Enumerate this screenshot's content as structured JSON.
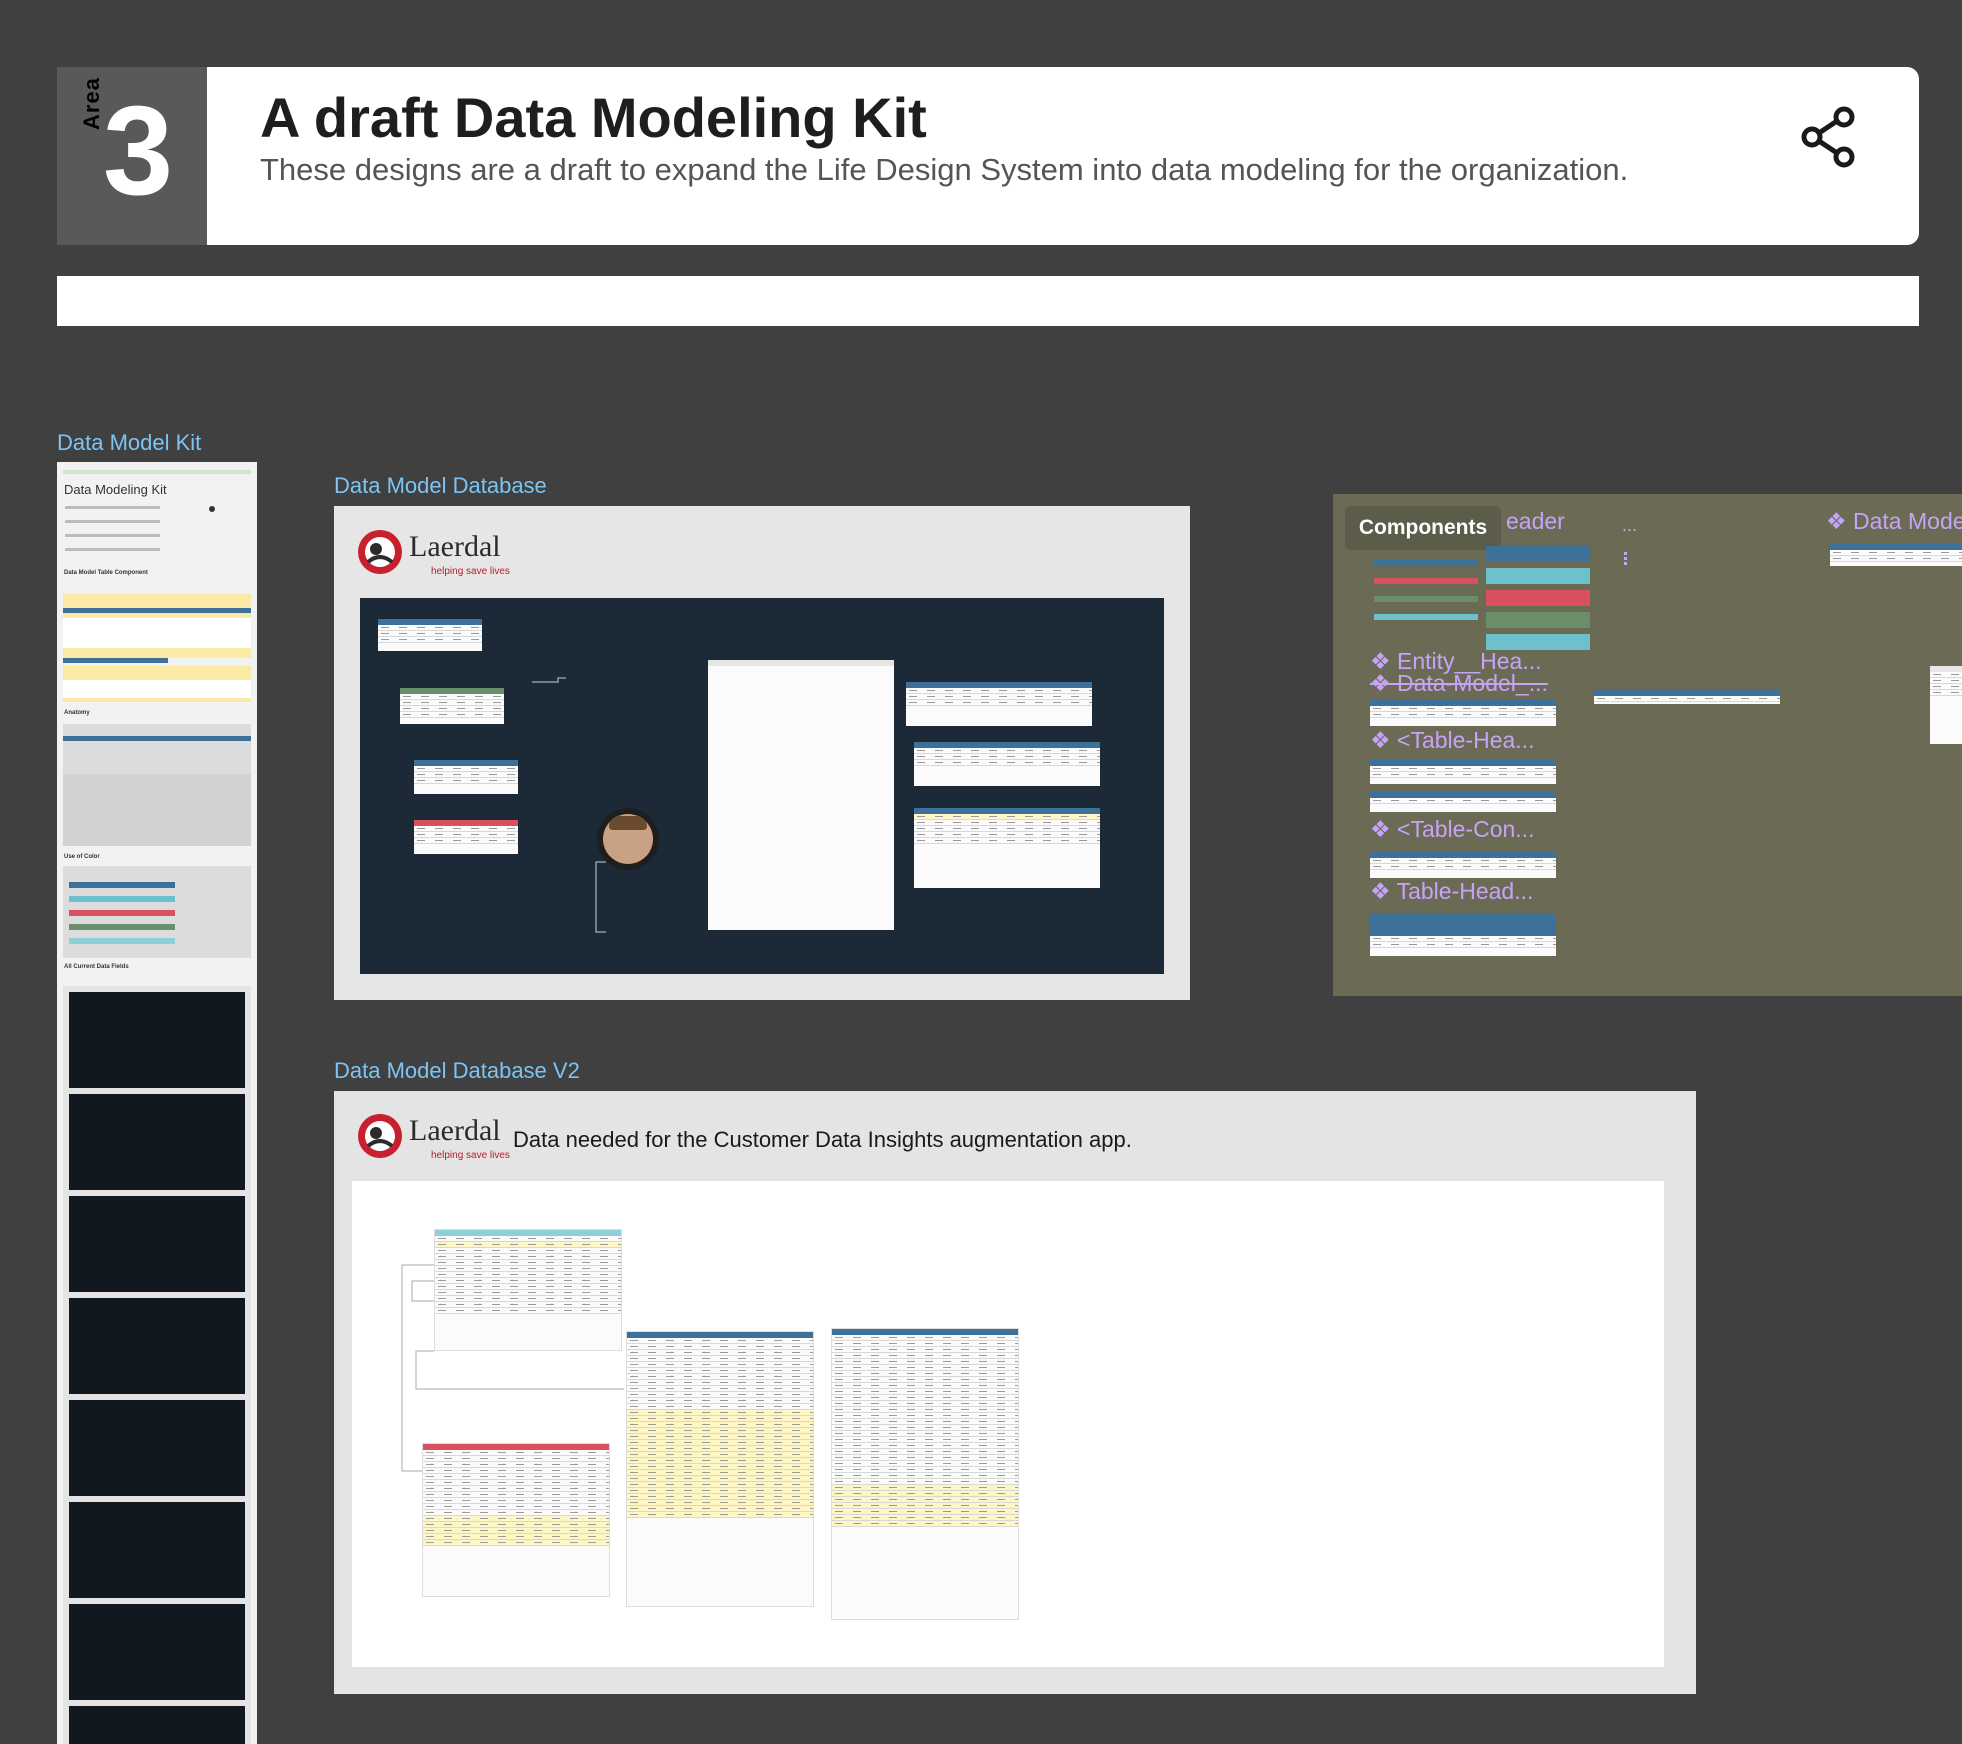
{
  "header": {
    "area_label": "Area",
    "area_number": "3",
    "title": "A draft Data Modeling Kit",
    "subtitle": "These designs are a draft to expand the Life Design System into data modeling for the organization."
  },
  "frames": {
    "kit": {
      "label": "Data Model Kit",
      "title": "Data Modeling Kit",
      "sections": [
        "Data Model Table Component",
        "Anatomy",
        "Use of Color",
        "All Current Data Fields"
      ]
    },
    "database": {
      "label": "Data Model Database"
    },
    "database_v2": {
      "label": "Data Model Database V2",
      "caption": "Data needed for the Customer Data Insights augmentation app."
    },
    "components": {
      "tag": "Components",
      "items": [
        "eader",
        "...",
        "Data Mode",
        "Entity__Hea...",
        "Data-Model_...",
        "<Table-Hea...",
        "<Table-Con...",
        "Table-Head..."
      ]
    }
  },
  "logo": {
    "name": "Laerdal",
    "tagline": "helping save lives"
  },
  "colors": {
    "canvas": "#404040",
    "label_blue": "#7cc4f4",
    "table_blue": "#3d7199",
    "table_green": "#6a8f6a",
    "table_red": "#d9515e",
    "table_teal": "#6cc1cc",
    "component_purple": "#c6a3f7",
    "dark_canvas": "#1b2a36"
  },
  "icons": {
    "share": "share-icon",
    "component": "component-diamond-icon"
  }
}
